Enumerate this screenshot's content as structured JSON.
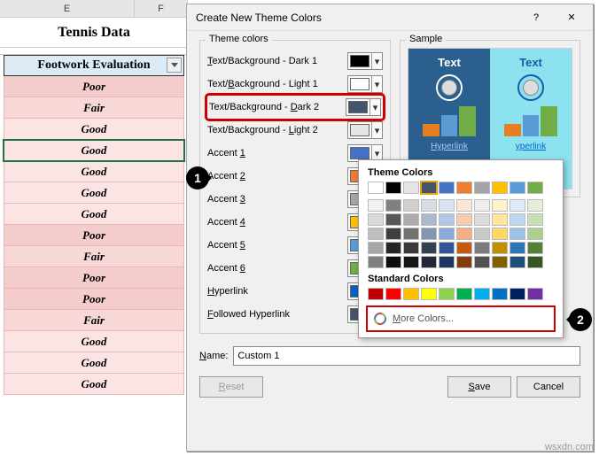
{
  "spreadsheet": {
    "columns": [
      "E",
      "F"
    ],
    "title": "Tennis Data",
    "header": "Footwork Evaluation",
    "rows": [
      "Poor",
      "Fair",
      "Good",
      "Good",
      "Good",
      "Good",
      "Good",
      "Poor",
      "Fair",
      "Poor",
      "Poor",
      "Fair",
      "Good",
      "Good",
      "Good"
    ]
  },
  "dialog": {
    "title": "Create New Theme Colors",
    "help_glyph": "?",
    "close_glyph": "✕",
    "theme_legend": "Theme colors",
    "sample_legend": "Sample",
    "options": [
      {
        "label_pre": "",
        "u": "T",
        "label_post": "ext/Background - Dark 1",
        "color": "#000000"
      },
      {
        "label_pre": "Text/",
        "u": "B",
        "label_post": "ackground - Light 1",
        "color": "#ffffff"
      },
      {
        "label_pre": "Text/Background - ",
        "u": "D",
        "label_post": "ark 2",
        "color": "#44546a"
      },
      {
        "label_pre": "Text/Background - ",
        "u": "L",
        "label_post": "ight 2",
        "color": "#e7e6e6"
      },
      {
        "label_pre": "Accent ",
        "u": "1",
        "label_post": "",
        "color": "#4472c4"
      },
      {
        "label_pre": "Accent ",
        "u": "2",
        "label_post": "",
        "color": "#ed7d31"
      },
      {
        "label_pre": "Accent ",
        "u": "3",
        "label_post": "",
        "color": "#a5a5a5"
      },
      {
        "label_pre": "Accent ",
        "u": "4",
        "label_post": "",
        "color": "#ffc000"
      },
      {
        "label_pre": "Accent ",
        "u": "5",
        "label_post": "",
        "color": "#5b9bd5"
      },
      {
        "label_pre": "Accent ",
        "u": "6",
        "label_post": "",
        "color": "#70ad47"
      },
      {
        "label_pre": "",
        "u": "H",
        "label_post": "yperlink",
        "color": "#0563c1"
      },
      {
        "label_pre": "",
        "u": "F",
        "label_post": "ollowed Hyperlink",
        "color": "#44546a"
      }
    ],
    "sample": {
      "text": "Text",
      "hyperlink": "Hyperlink",
      "yperlink": "yperlink"
    },
    "popup": {
      "theme_title": "Theme Colors",
      "std_title": "Standard Colors",
      "more": "More Colors...",
      "theme_row1": [
        "#ffffff",
        "#000000",
        "#e7e6e6",
        "#44546a",
        "#4472c4",
        "#ed7d31",
        "#a5a5a5",
        "#ffc000",
        "#5b9bd5",
        "#70ad47"
      ],
      "theme_shades": [
        [
          "#f2f2f2",
          "#7f7f7f",
          "#d0cece",
          "#d6dce5",
          "#d9e1f2",
          "#fce4d6",
          "#ededed",
          "#fff2cc",
          "#deebf7",
          "#e2efda"
        ],
        [
          "#d9d9d9",
          "#595959",
          "#aeaaaa",
          "#adb9ca",
          "#b4c6e7",
          "#f8cbad",
          "#dbdbdb",
          "#ffe699",
          "#bdd7ee",
          "#c6e0b4"
        ],
        [
          "#bfbfbf",
          "#404040",
          "#767171",
          "#8497b0",
          "#8ea9db",
          "#f4b084",
          "#c9c9c9",
          "#ffd966",
          "#9bc2e6",
          "#a9d08e"
        ],
        [
          "#a6a6a6",
          "#262626",
          "#3b3838",
          "#333f4f",
          "#305496",
          "#c65911",
          "#7b7b7b",
          "#bf8f00",
          "#2e75b6",
          "#548235"
        ],
        [
          "#808080",
          "#0d0d0d",
          "#161616",
          "#222b35",
          "#203764",
          "#833c0c",
          "#525252",
          "#806000",
          "#1f4e78",
          "#375623"
        ]
      ],
      "standard": [
        "#c00000",
        "#ff0000",
        "#ffc000",
        "#ffff00",
        "#92d050",
        "#00b050",
        "#00b0f0",
        "#0070c0",
        "#002060",
        "#7030a0"
      ]
    },
    "name_label": "Name:",
    "name_value": "Custom 1",
    "reset": "Reset",
    "save": "Save",
    "cancel": "Cancel"
  },
  "callouts": {
    "one": "1",
    "two": "2"
  },
  "watermark": "wsxdn.com"
}
